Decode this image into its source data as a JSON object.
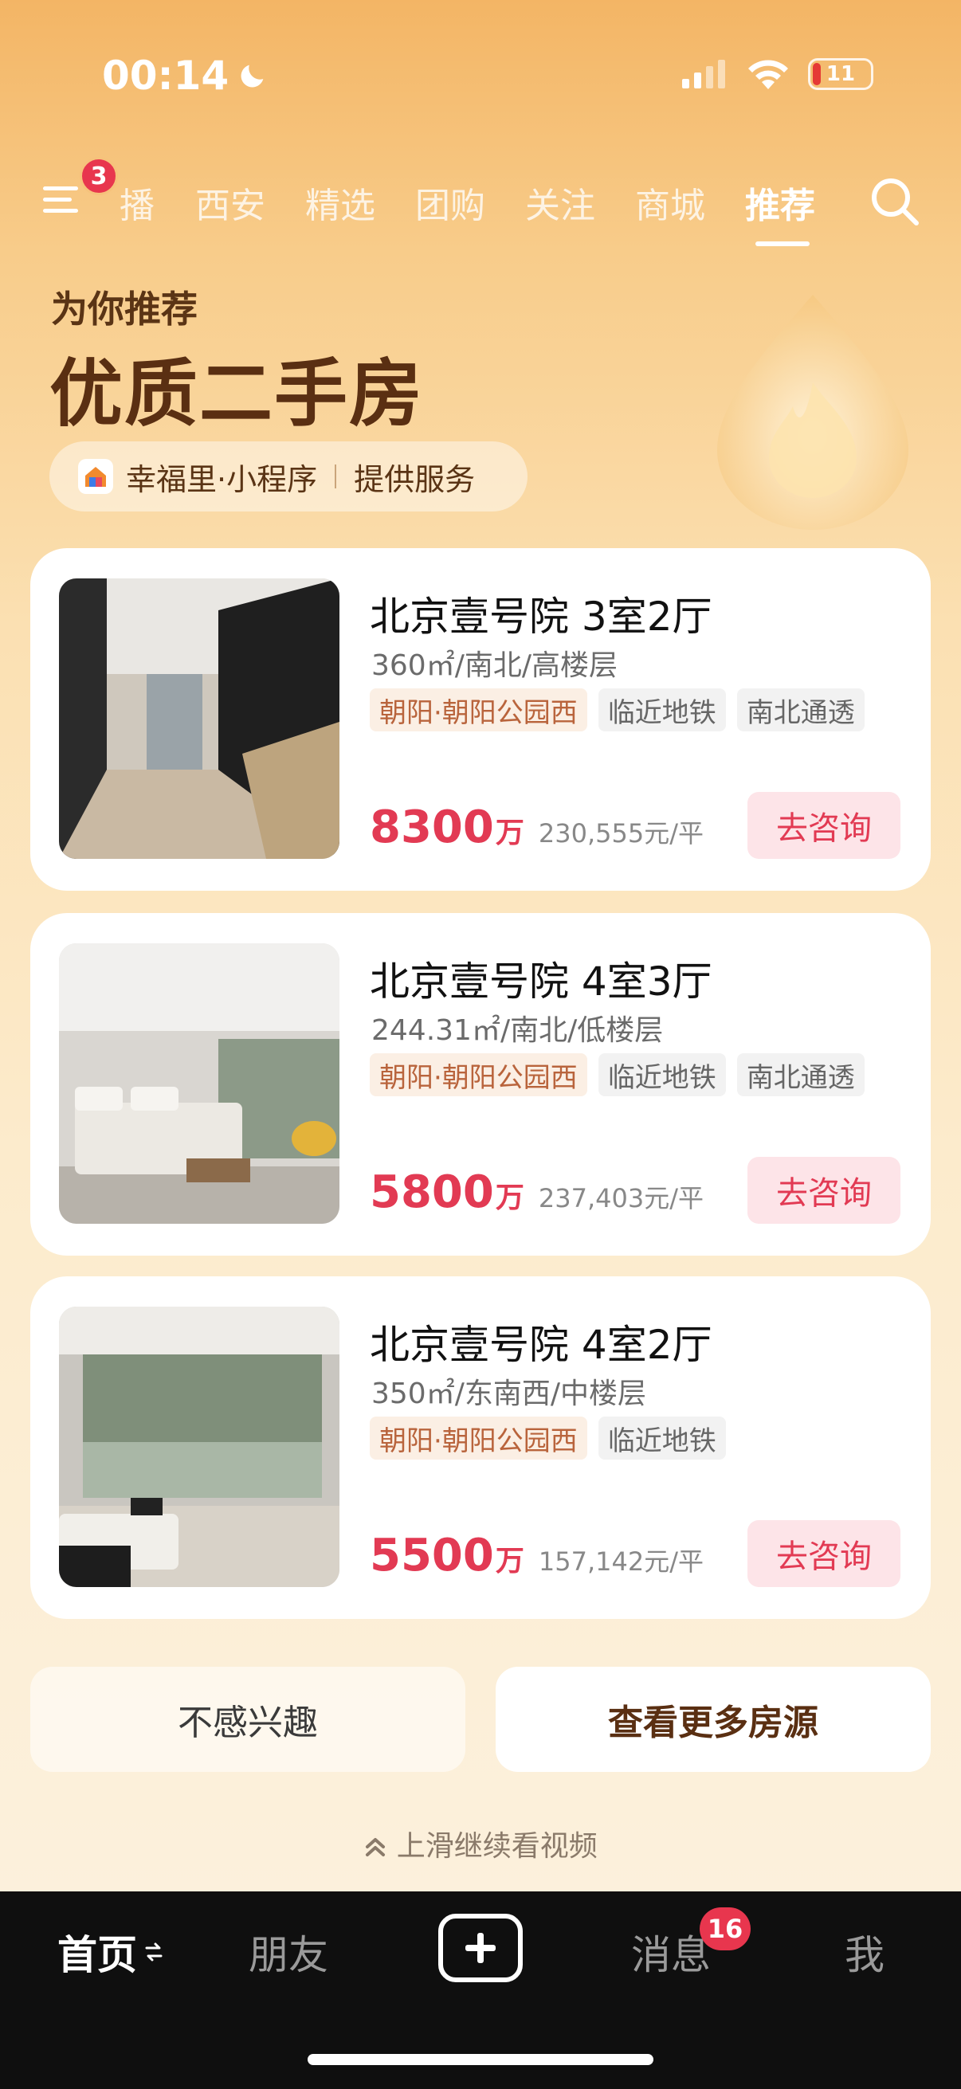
{
  "status_bar": {
    "time": "00:14",
    "battery": "11"
  },
  "top_nav": {
    "menu_badge": "3",
    "tabs": [
      "播",
      "西安",
      "精选",
      "团购",
      "关注",
      "商城",
      "推荐"
    ],
    "active_tab": "推荐"
  },
  "hero": {
    "subtitle": "为你推荐",
    "title": "优质二手房",
    "provider_name": "幸福里·小程序",
    "provider_suffix": "提供服务"
  },
  "listings": [
    {
      "title": "北京壹号院 3室2厅",
      "meta": "360㎡/南北/高楼层",
      "tags": [
        "朝阳·朝阳公园西",
        "临近地铁",
        "南北通透"
      ],
      "price": "8300",
      "price_unit": "万",
      "price_per_sqm": "230,555元/平",
      "cta": "去咨询"
    },
    {
      "title": "北京壹号院 4室3厅",
      "meta": "244.31㎡/南北/低楼层",
      "tags": [
        "朝阳·朝阳公园西",
        "临近地铁",
        "南北通透"
      ],
      "price": "5800",
      "price_unit": "万",
      "price_per_sqm": "237,403元/平",
      "cta": "去咨询"
    },
    {
      "title": "北京壹号院 4室2厅",
      "meta": "350㎡/东南西/中楼层",
      "tags": [
        "朝阳·朝阳公园西",
        "临近地铁"
      ],
      "price": "5500",
      "price_unit": "万",
      "price_per_sqm": "157,142元/平",
      "cta": "去咨询"
    }
  ],
  "actions": {
    "not_interested": "不感兴趣",
    "more_listings": "查看更多房源"
  },
  "swipe_hint": "上滑继续看视频",
  "bottom_nav": {
    "home": "首页",
    "friends": "朋友",
    "messages": "消息",
    "messages_badge": "16",
    "me": "我"
  },
  "colors": {
    "accent_price": "#e23a53",
    "hero_brown": "#5a2f12",
    "tag_loc": "#b9643c"
  }
}
